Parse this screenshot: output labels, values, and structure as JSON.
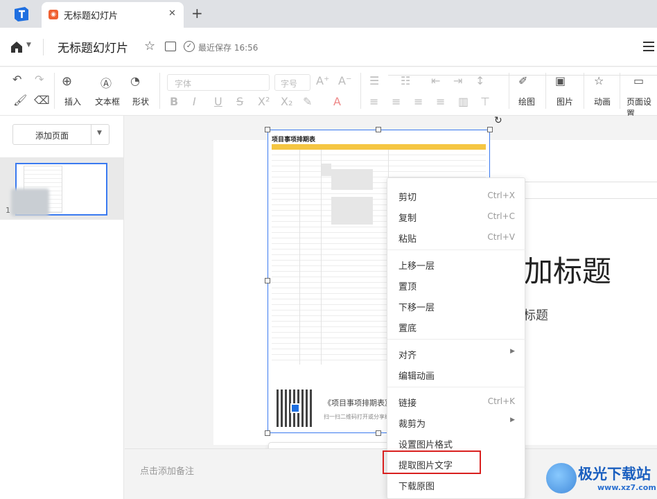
{
  "tab": {
    "title": "无标题幻灯片",
    "close": "✕",
    "new": "+"
  },
  "titlebar": {
    "doc_title": "无标题幻灯片",
    "save_status": "最近保存 16:56"
  },
  "toolbar": {
    "insert": "插入",
    "textbox": "文本框",
    "shape": "形状",
    "font_placeholder": "字体",
    "size_placeholder": "字号",
    "draw": "绘图",
    "picture": "图片",
    "animation": "动画",
    "page_setup": "页面设置"
  },
  "sidebar": {
    "add_page": "添加页面",
    "slide_number": "1"
  },
  "slide": {
    "title_placeholder": "加标题",
    "subtitle_placeholder": "标题"
  },
  "picture": {
    "sheet_title": "项目事项排期表",
    "caption": "《项目事项排期表》",
    "sub_caption": "扫一扫二维码打开或分享给"
  },
  "context_menu": {
    "cut": "剪切",
    "cut_key": "Ctrl+X",
    "copy": "复制",
    "copy_key": "Ctrl+C",
    "paste": "粘贴",
    "paste_key": "Ctrl+V",
    "bring_forward": "上移一层",
    "bring_front": "置顶",
    "send_backward": "下移一层",
    "send_back": "置底",
    "align": "对齐",
    "edit_animation": "编辑动画",
    "link": "链接",
    "link_key": "Ctrl+K",
    "crop": "裁剪为",
    "image_format": "设置图片格式",
    "extract_text": "提取图片文字",
    "download": "下载原图"
  },
  "notes": {
    "placeholder": "点击添加备注"
  },
  "watermark": {
    "name": "极光下载站",
    "url": "www.xz7.com"
  },
  "colors": {
    "accent": "#3a7af0",
    "highlight": "#d9201f",
    "tab_icon": "#ef6031"
  }
}
